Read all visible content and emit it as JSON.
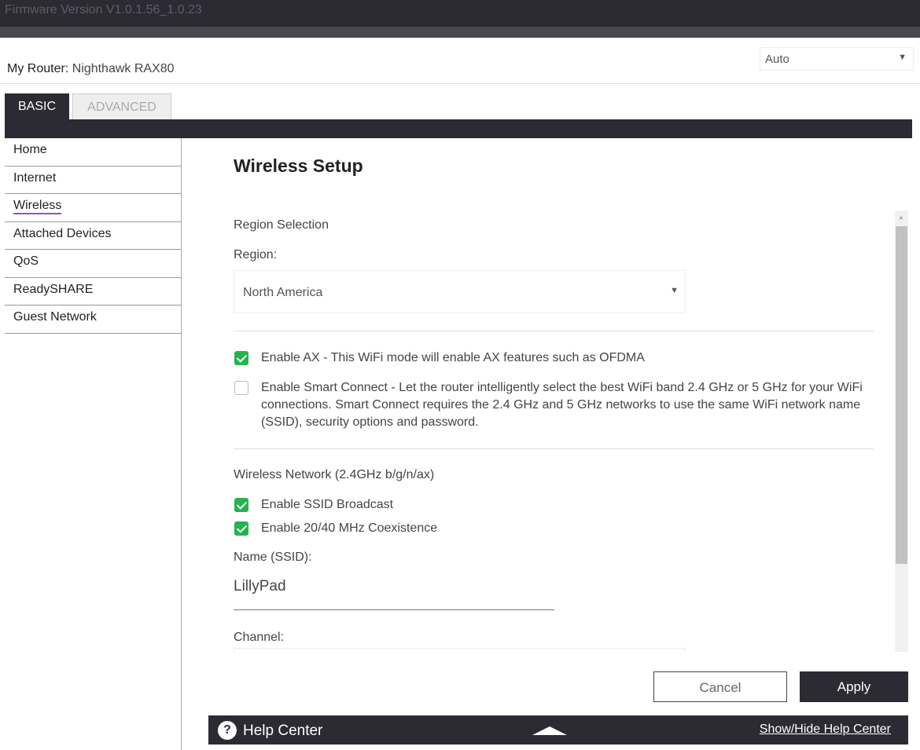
{
  "firmware": "Firmware Version V1.0.1.56_1.0.23",
  "router": {
    "label": "My Router:",
    "name": "Nighthawk RAX80"
  },
  "language": {
    "selected": "Auto"
  },
  "tabs": {
    "basic": "BASIC",
    "advanced": "ADVANCED"
  },
  "sidebar": {
    "items": [
      {
        "label": "Home"
      },
      {
        "label": "Internet"
      },
      {
        "label": "Wireless"
      },
      {
        "label": "Attached Devices"
      },
      {
        "label": "QoS"
      },
      {
        "label": "ReadySHARE"
      },
      {
        "label": "Guest Network"
      }
    ],
    "active": "Wireless"
  },
  "page": {
    "title": "Wireless Setup"
  },
  "region": {
    "section": "Region Selection",
    "label": "Region:",
    "selected": "North America"
  },
  "options": {
    "enable_ax": {
      "label": "Enable AX - This WiFi mode will enable AX features such as OFDMA",
      "checked": true
    },
    "smart_connect": {
      "label": "Enable Smart Connect - Let the router intelligently select the best WiFi band 2.4 GHz or 5 GHz for your WiFi connections. Smart Connect requires the 2.4 GHz and 5 GHz networks to use the same WiFi network name (SSID), security options and password.",
      "checked": false
    }
  },
  "network24": {
    "section": "Wireless Network (2.4GHz b/g/n/ax)",
    "ssid_broadcast": {
      "label": "Enable SSID Broadcast",
      "checked": true
    },
    "coexistence": {
      "label": "Enable 20/40 MHz Coexistence",
      "checked": true
    },
    "ssid_label": "Name (SSID):",
    "ssid_value": "LillyPad",
    "channel_label": "Channel:"
  },
  "buttons": {
    "cancel": "Cancel",
    "apply": "Apply"
  },
  "help": {
    "title": "Help Center",
    "toggle": "Show/Hide Help Center"
  },
  "colors": {
    "dark": "#2c2a33",
    "check": "#23b44f",
    "active_underline": "#a24db5"
  },
  "icons": {
    "help": "question-circle-icon",
    "collapse": "caret-up-icon",
    "dropdown": "triangle-down-icon"
  }
}
